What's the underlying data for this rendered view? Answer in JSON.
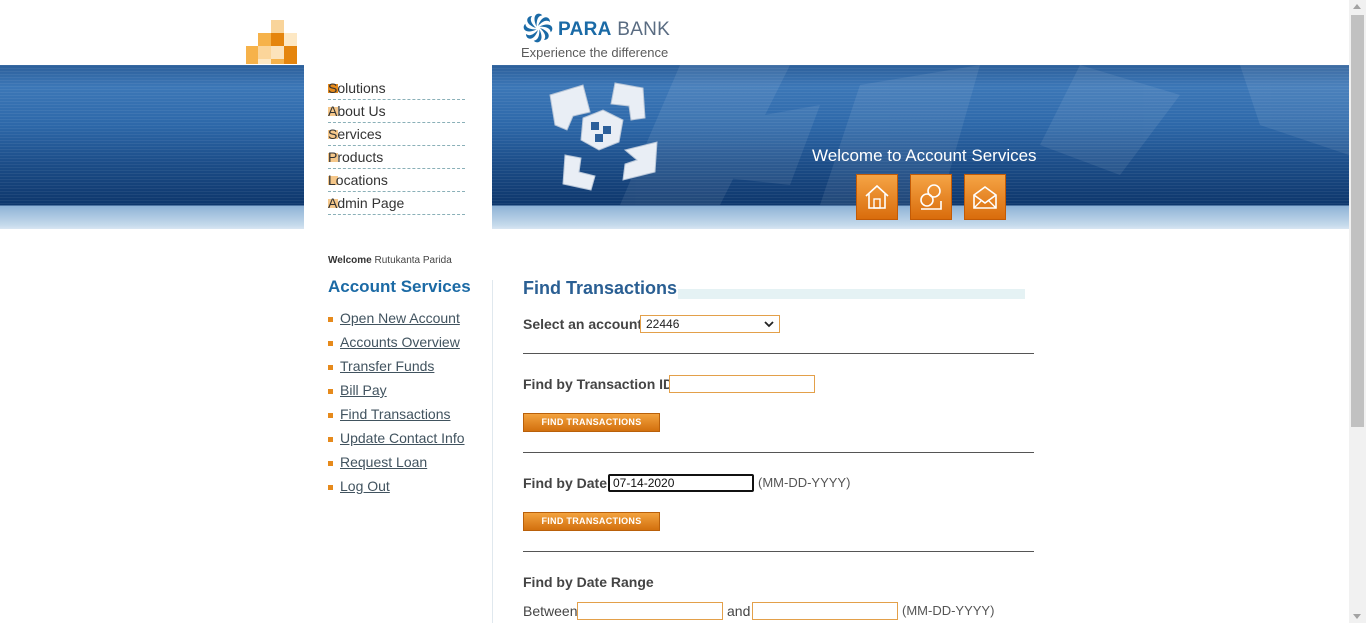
{
  "brand": {
    "name_bold": "PARA",
    "name_rest": " BANK",
    "caption": "Experience the difference"
  },
  "nav": {
    "items": [
      "Solutions",
      "About Us",
      "Services",
      "Products",
      "Locations",
      "Admin Page"
    ]
  },
  "header": {
    "welcome_title": "Welcome to Account Services"
  },
  "user": {
    "welcome_label": "Welcome",
    "name": "Rutukanta Parida"
  },
  "sidebar": {
    "title": "Account Services",
    "links": [
      "Open New Account",
      "Accounts Overview",
      "Transfer Funds",
      "Bill Pay",
      "Find Transactions",
      "Update Contact Info",
      "Request Loan",
      "Log Out"
    ]
  },
  "main": {
    "title": "Find Transactions",
    "account_label": "Select an account",
    "account_value": "22446",
    "by_id_label": "Find by Transaction ID",
    "by_id_value": "",
    "find_button": "FIND TRANSACTIONS",
    "by_date_label": "Find by Date",
    "by_date_value": "07-14-2020",
    "date_hint": "(MM-DD-YYYY)",
    "by_range_label": "Find by Date Range",
    "between_label": "Between",
    "and_label": "and",
    "range_from": "",
    "range_to": ""
  },
  "colors": {
    "accent": "#e68a1c",
    "link_blue": "#1b6aa5",
    "band_blue": "#1b4c87"
  },
  "icons": [
    "home-icon",
    "about-icon",
    "contact-icon"
  ]
}
